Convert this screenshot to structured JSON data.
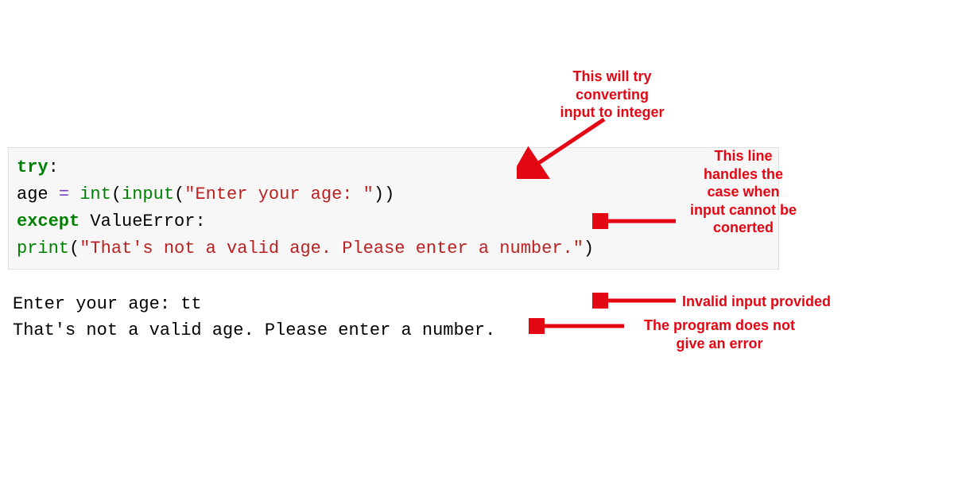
{
  "code": {
    "line1_kw": "try",
    "line1_colon": ":",
    "line2_indent": "    ",
    "line2_var": "age ",
    "line2_eq": "= ",
    "line2_int": "int",
    "line2_open": "(",
    "line2_input": "input",
    "line2_open2": "(",
    "line2_str": "\"Enter your age: \"",
    "line2_close": "))",
    "line3_kw": "except",
    "line3_space": " ",
    "line3_err": "ValueError",
    "line3_colon": ":",
    "line4_indent": "    ",
    "line4_print": "print",
    "line4_open": "(",
    "line4_str": "\"That's not a valid age. Please enter a number.\"",
    "line4_close": ")"
  },
  "output": {
    "line1": "Enter your age: tt",
    "line2": "That's not a valid age. Please enter a number."
  },
  "annotations": {
    "a1_l1": "This will try",
    "a1_l2": "converting",
    "a1_l3": "input to integer",
    "a2_l1": "This line",
    "a2_l2": "handles the",
    "a2_l3": "case when",
    "a2_l4": "input cannot be",
    "a2_l5": "conerted",
    "a3": "Invalid input provided",
    "a4_l1": "The program does not",
    "a4_l2": "give an error"
  },
  "colors": {
    "annotation": "#e30613"
  }
}
